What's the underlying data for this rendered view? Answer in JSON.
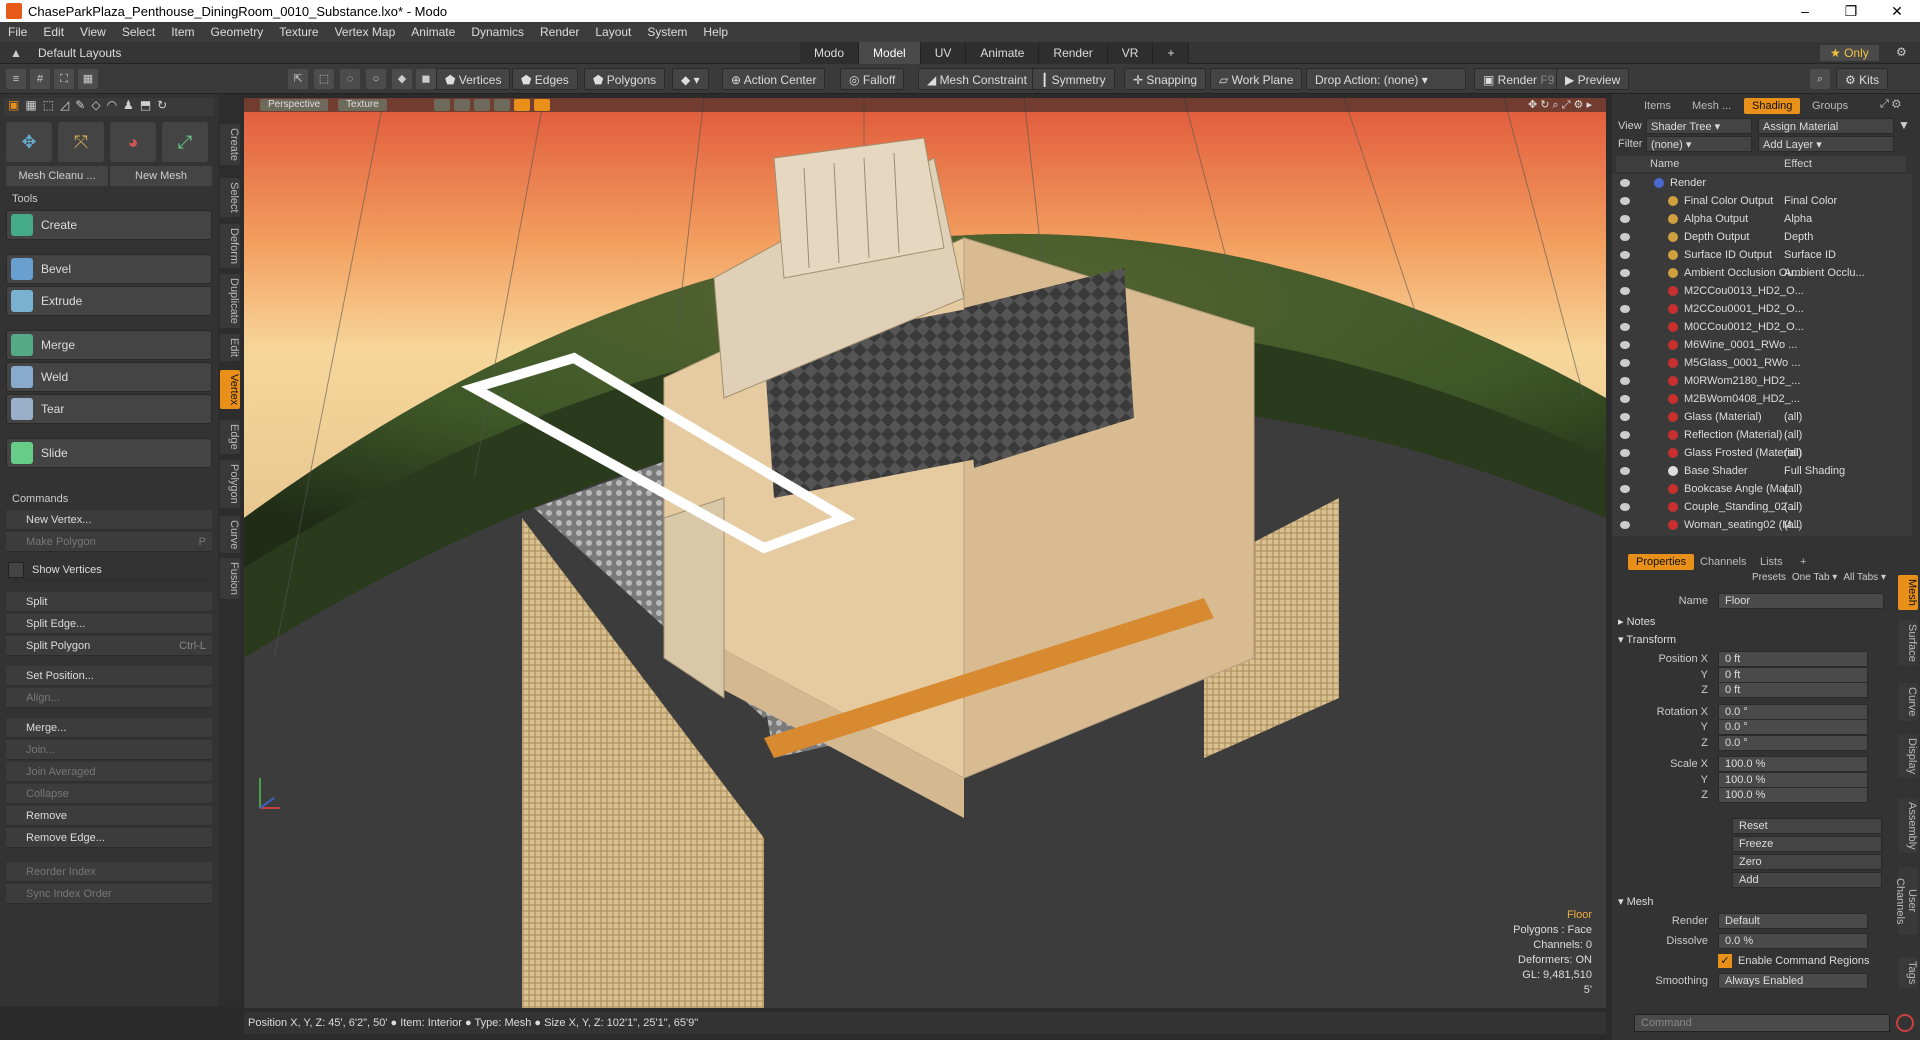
{
  "window": {
    "title": "ChaseParkPlaza_Penthouse_DiningRoom_0010_Substance.lxo* - Modo",
    "min": "–",
    "max": "❐",
    "close": "✕"
  },
  "menu": [
    "File",
    "Edit",
    "View",
    "Select",
    "Item",
    "Geometry",
    "Texture",
    "Vertex Map",
    "Animate",
    "Dynamics",
    "Render",
    "Layout",
    "System",
    "Help"
  ],
  "layout": {
    "name": "Default Layouts",
    "tabs": [
      "Modo",
      "Model",
      "UV",
      "Animate",
      "Render",
      "VR",
      "+"
    ],
    "active_tab": "Model",
    "only": "★ Only"
  },
  "toolbar": {
    "vertices": "Vertices",
    "edges": "Edges",
    "polygons": "Polygons",
    "action_center": "Action Center",
    "falloff": "Falloff",
    "mesh_constraint": "Mesh Constraint",
    "symmetry": "Symmetry",
    "snapping": "Snapping",
    "work_plane": "Work Plane",
    "drop_action": "Drop Action: (none)",
    "render": "Render",
    "render_key": "F9",
    "preview": "Preview",
    "kits": "Kits"
  },
  "left": {
    "mesh_cleanup": "Mesh Cleanu ...",
    "new_mesh": "New Mesh",
    "tools_head": "Tools",
    "create": "Create",
    "bevel": "Bevel",
    "extrude": "Extrude",
    "merge": "Merge",
    "weld": "Weld",
    "tear": "Tear",
    "slide": "Slide",
    "commands_head": "Commands",
    "new_vertex": "New Vertex...",
    "make_polygon": "Make Polygon",
    "make_polygon_key": "P",
    "show_vertices": "Show Vertices",
    "split": "Split",
    "split_edge": "Split Edge...",
    "split_polygon": "Split Polygon",
    "split_polygon_key": "Ctrl-L",
    "set_position": "Set Position...",
    "align": "Align...",
    "merge2": "Merge...",
    "join": "Join...",
    "join_avg": "Join Averaged",
    "collapse": "Collapse",
    "remove": "Remove",
    "remove_edge": "Remove Edge...",
    "reorder": "Reorder Index",
    "sync": "Sync Index Order",
    "vtabs": [
      "Create",
      "Select",
      "Deform",
      "Duplicate",
      "Edit",
      "Vertex",
      "Edge",
      "Polygon",
      "Curve",
      "Fusion"
    ],
    "active_vtab": "Vertex"
  },
  "viewport": {
    "perspective": "Perspective",
    "texture": "Texture",
    "info": {
      "item": "Floor",
      "polygons": "Polygons : Face",
      "channels": "Channels: 0",
      "deformers": "Deformers: ON",
      "gl": "GL: 9,481,510",
      "unit": "5'"
    }
  },
  "status": "Position X, Y, Z:  45', 6'2\", 50'  ●  Item:  Interior  ●  Type:  Mesh  ●  Size X, Y, Z:  102'1\", 25'1\", 65'9\"",
  "right": {
    "tabs": [
      "Items",
      "Mesh ...",
      "Shading",
      "Groups"
    ],
    "active_tab": "Shading",
    "view_label": "View",
    "view_value": "Shader Tree",
    "assign": "Assign Material",
    "filter_label": "Filter",
    "filter_value": "(none)",
    "add_layer": "Add Layer",
    "col_name": "Name",
    "col_effect": "Effect",
    "tree": [
      {
        "name": "Render",
        "effect": "",
        "color": "#4a6ad0",
        "indent": 0
      },
      {
        "name": "Final Color Output",
        "effect": "Final Color",
        "color": "#d0a040",
        "indent": 1
      },
      {
        "name": "Alpha Output",
        "effect": "Alpha",
        "color": "#d0a040",
        "indent": 1
      },
      {
        "name": "Depth Output",
        "effect": "Depth",
        "color": "#d0a040",
        "indent": 1
      },
      {
        "name": "Surface ID Output",
        "effect": "Surface ID",
        "color": "#d0a040",
        "indent": 1
      },
      {
        "name": "Ambient Occlusion Ou...",
        "effect": "Ambient Occlu...",
        "color": "#d0a040",
        "indent": 1
      },
      {
        "name": "M2CCou0013_HD2_O...",
        "effect": "",
        "color": "#c83030",
        "indent": 1
      },
      {
        "name": "M2CCou0001_HD2_O...",
        "effect": "",
        "color": "#c83030",
        "indent": 1
      },
      {
        "name": "M0CCou0012_HD2_O...",
        "effect": "",
        "color": "#c83030",
        "indent": 1
      },
      {
        "name": "M6Wine_0001_RWo ...",
        "effect": "",
        "color": "#c83030",
        "indent": 1
      },
      {
        "name": "M5Glass_0001_RWo ...",
        "effect": "",
        "color": "#c83030",
        "indent": 1
      },
      {
        "name": "M0RWom2180_HD2_...",
        "effect": "",
        "color": "#c83030",
        "indent": 1
      },
      {
        "name": "M2BWom0408_HD2_...",
        "effect": "",
        "color": "#c83030",
        "indent": 1
      },
      {
        "name": "Glass (Material)",
        "effect": "(all)",
        "color": "#c83030",
        "indent": 1
      },
      {
        "name": "Reflection (Material)",
        "effect": "(all)",
        "color": "#c83030",
        "indent": 1
      },
      {
        "name": "Glass Frosted (Material)",
        "effect": "(all)",
        "color": "#c83030",
        "indent": 1
      },
      {
        "name": "Base Shader",
        "effect": "Full Shading",
        "color": "#dddddd",
        "indent": 1
      },
      {
        "name": "Bookcase Angle (Mat...",
        "effect": "(all)",
        "color": "#c83030",
        "indent": 1
      },
      {
        "name": "Couple_Standing_02 ...",
        "effect": "(all)",
        "color": "#c83030",
        "indent": 1
      },
      {
        "name": "Woman_seating02 (M...",
        "effect": "(all)",
        "color": "#c83030",
        "indent": 1
      }
    ],
    "ptabs": [
      "Properties",
      "Channels",
      "Lists",
      "+"
    ],
    "active_ptab": "Properties",
    "presets": "Presets",
    "one_tab": "One Tab ▾",
    "all_tabs": "All Tabs ▾",
    "name_label": "Name",
    "name_value": "Floor",
    "notes": "Notes",
    "transform": "Transform",
    "props": [
      {
        "label": "Position X",
        "value": "0 ft"
      },
      {
        "label": "Y",
        "value": "0 ft"
      },
      {
        "label": "Z",
        "value": "0 ft"
      },
      {
        "label": "Rotation X",
        "value": "0.0 °"
      },
      {
        "label": "Y",
        "value": "0.0 °"
      },
      {
        "label": "Z",
        "value": "0.0 °"
      },
      {
        "label": "Scale X",
        "value": "100.0 %"
      },
      {
        "label": "Y",
        "value": "100.0 %"
      },
      {
        "label": "Z",
        "value": "100.0 %"
      }
    ],
    "reset": "Reset",
    "freeze": "Freeze",
    "zero": "Zero",
    "add": "Add",
    "mesh_head": "Mesh",
    "render_label": "Render",
    "render_value": "Default",
    "dissolve_label": "Dissolve",
    "dissolve_value": "0.0 %",
    "enable_cmd": "Enable Command Regions",
    "smoothing_label": "Smoothing",
    "smoothing_value": "Always Enabled",
    "command_placeholder": "Command",
    "rvtabs": [
      "Mesh",
      "Surface",
      "Curve",
      "Display",
      "Assembly",
      "User Channels",
      "Tags"
    ]
  }
}
